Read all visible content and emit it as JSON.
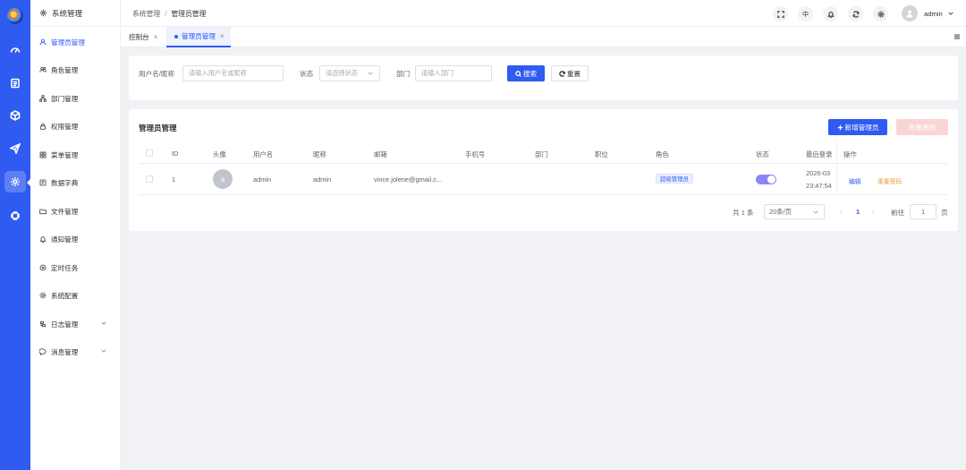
{
  "sidebar": {
    "title": "系统管理",
    "items": [
      {
        "label": "管理员管理"
      },
      {
        "label": "角色管理"
      },
      {
        "label": "部门管理"
      },
      {
        "label": "权限管理"
      },
      {
        "label": "菜单管理"
      },
      {
        "label": "数据字典"
      },
      {
        "label": "文件管理"
      },
      {
        "label": "通知管理"
      },
      {
        "label": "定时任务"
      },
      {
        "label": "系统配置"
      },
      {
        "label": "日志管理"
      },
      {
        "label": "消息管理"
      }
    ]
  },
  "header": {
    "breadcrumb": [
      "系统管理",
      "管理员管理"
    ],
    "breadcrumb_sep": "/",
    "lang": "中",
    "username": "admin"
  },
  "tabs": [
    {
      "label": "控制台",
      "close": "×"
    },
    {
      "label": "管理员管理",
      "close": "×"
    }
  ],
  "search": {
    "name_label": "用户名/昵称",
    "name_placeholder": "请输入用户名或昵称",
    "status_label": "状态",
    "status_placeholder": "请选择状态",
    "dept_label": "部门",
    "dept_placeholder": "请输入部门",
    "search_btn": "搜索",
    "reset_btn": "重置"
  },
  "table": {
    "title": "管理员管理",
    "add_btn": "新增管理员",
    "batch_delete_btn": "批量删除",
    "columns": [
      "ID",
      "头像",
      "用户名",
      "昵称",
      "邮箱",
      "手机号",
      "部门",
      "职位",
      "角色",
      "状态",
      "最后登录",
      "操作"
    ],
    "rows": [
      {
        "id": "1",
        "avatar": "a",
        "username": "admin",
        "nickname": "admin",
        "email": "vince.jolene@gmail.c...",
        "phone": "",
        "dept": "",
        "position": "",
        "role": "超级管理员",
        "status_on": true,
        "last_login_date": "2026-03",
        "last_login_time": "23:47:54",
        "action_edit": "编辑",
        "action_reset": "重置密码"
      }
    ]
  },
  "pagination": {
    "total": "共 1 条",
    "page_size": "20条/页",
    "prev": "‹",
    "current": "1",
    "next": "›",
    "goto_label": "前往",
    "goto_value": "1",
    "page_suffix": "页"
  },
  "colors": {
    "primary": "#2f5bf0",
    "warning": "#e6a23c",
    "switch_on": "#8e86f0"
  }
}
